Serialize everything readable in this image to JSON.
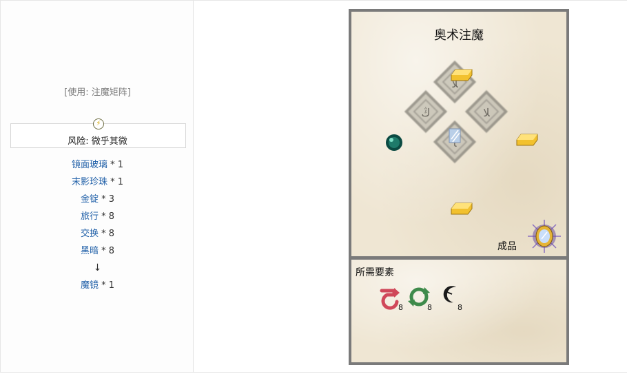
{
  "left": {
    "usage": "[使用: 注魔矩阵]",
    "risk_icon": "lightning-icon",
    "risk": "风险: 微乎其微",
    "ingredients": [
      {
        "name": "镜面玻璃",
        "qty": " * 1"
      },
      {
        "name": "末影珍珠",
        "qty": " * 1"
      },
      {
        "name": "金锭",
        "qty": " * 3"
      },
      {
        "name": "旅行",
        "qty": " * 8"
      },
      {
        "name": "交换",
        "qty": " * 8"
      },
      {
        "name": "黑暗",
        "qty": " * 8"
      }
    ],
    "arrow": "↓",
    "result": {
      "name": "魔镜",
      "qty": " * 1"
    }
  },
  "recipe": {
    "title": "奥术注魔",
    "product_label": "成品",
    "required_label": "所需要素",
    "aspects": [
      {
        "icon": "travel-aspect-icon",
        "count": "8",
        "color": "#d0485a"
      },
      {
        "icon": "exchange-aspect-icon",
        "count": "8",
        "color": "#3e8a4a"
      },
      {
        "icon": "darkness-aspect-icon",
        "count": "8",
        "color": "#1a1a1a"
      }
    ],
    "colors": {
      "frame": "#7a7a7a",
      "parchment": "#efe6d3",
      "link": "#1f5fa8"
    }
  }
}
